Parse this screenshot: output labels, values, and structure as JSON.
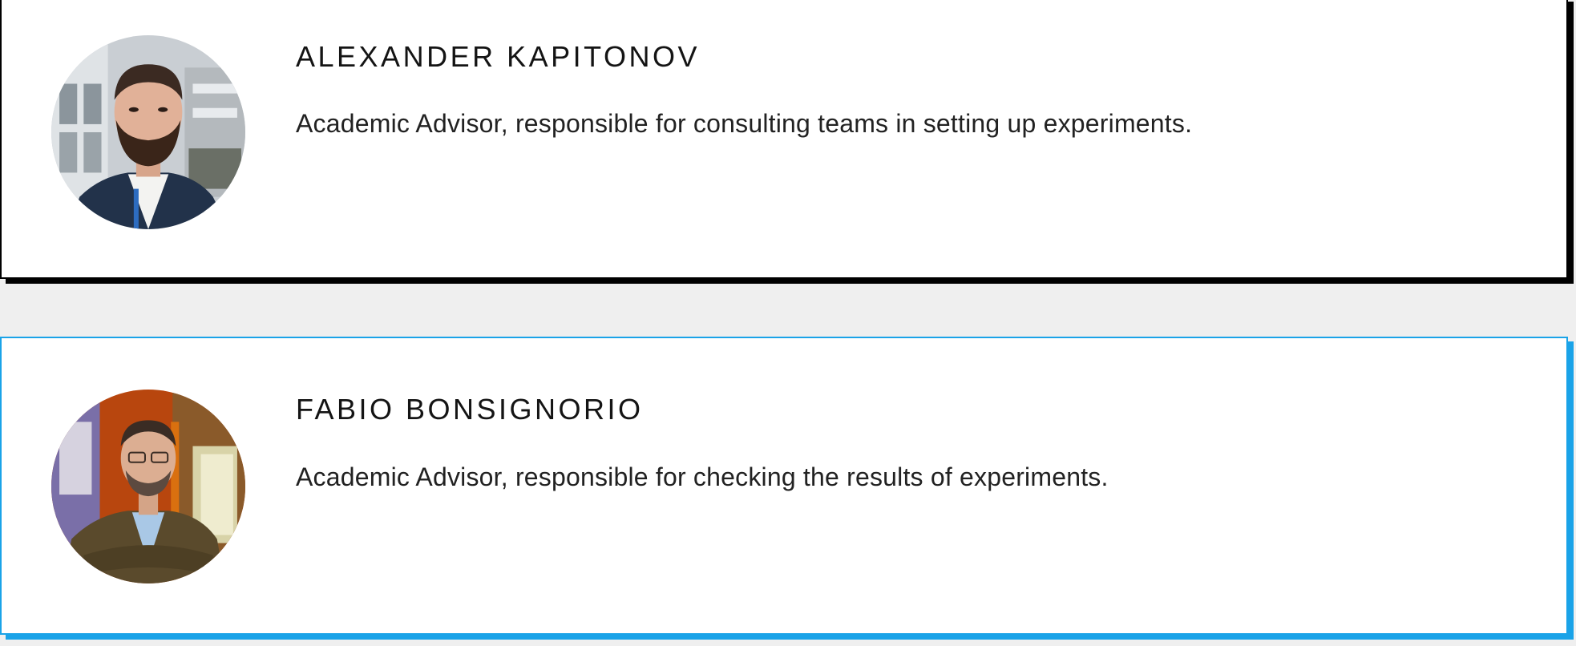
{
  "advisors": [
    {
      "name": "ALEXANDER KAPITONOV",
      "description": "Academic Advisor, responsible for consulting teams in setting up experiments.",
      "photo_icon": "portrait-photo",
      "accent_color": "#000000"
    },
    {
      "name": "FABIO BONSIGNORIO",
      "description": "Academic Advisor, responsible for checking the results of experiments.",
      "photo_icon": "portrait-photo",
      "accent_color": "#1aa3e8"
    }
  ],
  "colors": {
    "background": "#efefef",
    "card": "#ffffff"
  }
}
